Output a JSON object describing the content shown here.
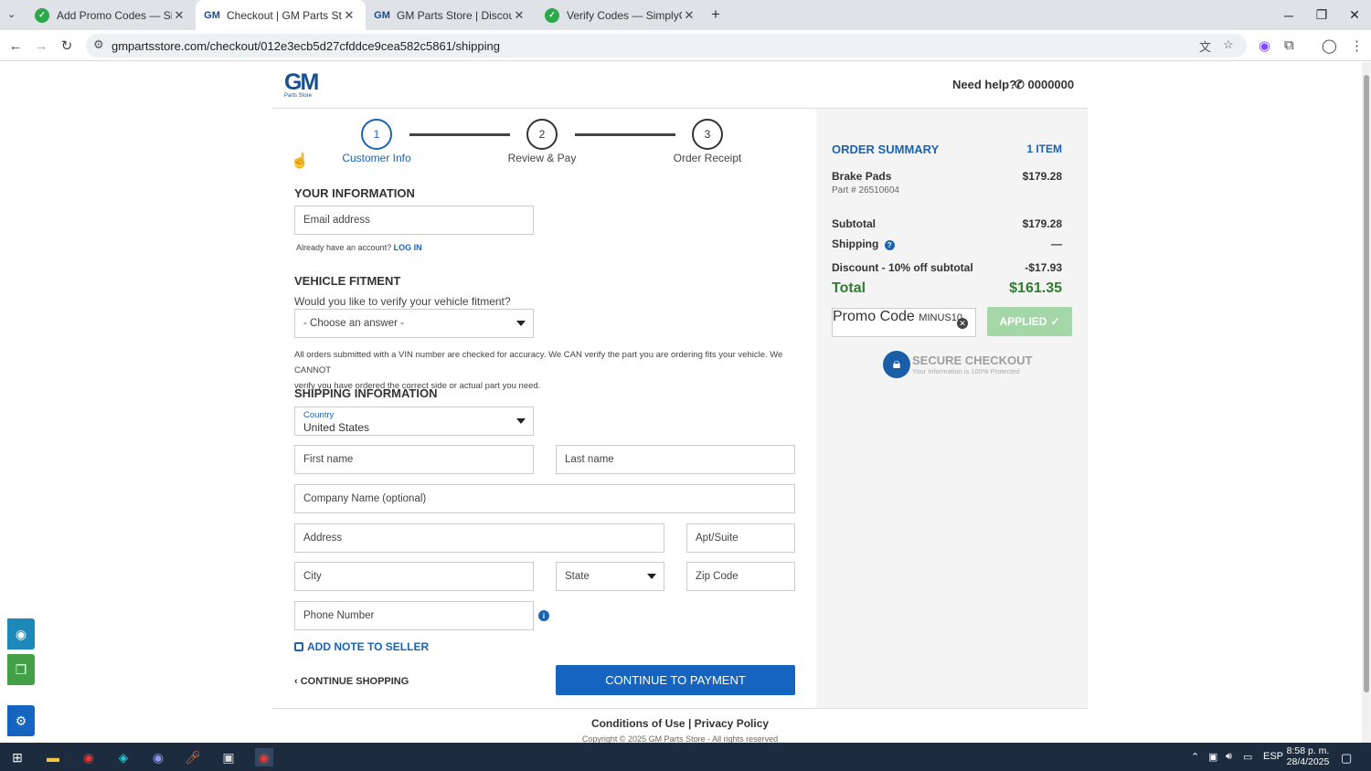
{
  "browser": {
    "tabs": [
      {
        "title": "Add Promo Codes — SimplyCo",
        "favicon": "simplycodes-icon",
        "active": false
      },
      {
        "title": "Checkout | GM Parts Store",
        "favicon": "gm-icon",
        "active": true
      },
      {
        "title": "GM Parts Store | Discount GM P",
        "favicon": "gm-icon",
        "active": false
      },
      {
        "title": "Verify Codes — SimplyCodes",
        "favicon": "simplycodes-icon",
        "active": false
      }
    ],
    "url": "gmpartsstore.com/checkout/012e3ecb5d27cfddce9cea582c5861/shipping"
  },
  "header": {
    "logo_text": "GM",
    "logo_sub": "Parts Store",
    "need_help": "Need help?",
    "phone": "0000000"
  },
  "stepper": {
    "steps": [
      {
        "number": "1",
        "label": "Customer Info"
      },
      {
        "number": "2",
        "label": "Review & Pay"
      },
      {
        "number": "3",
        "label": "Order Receipt"
      }
    ]
  },
  "your_info": {
    "heading": "YOUR INFORMATION",
    "email_placeholder": "Email address",
    "account_prompt": "Already have an account?",
    "login_link": "LOG IN"
  },
  "vehicle": {
    "heading": "VEHICLE FITMENT",
    "question": "Would you like to verify your vehicle fitment?",
    "select_value": "- Choose an answer -",
    "disclaimer_line1": "All orders submitted with a VIN number are checked for accuracy. We CAN verify the part you are ordering fits your vehicle. We CANNOT",
    "disclaimer_line2": "verify you have ordered the correct side or actual part you need."
  },
  "shipping": {
    "heading": "SHIPPING INFORMATION",
    "country_label": "Country",
    "country_value": "United States",
    "first_name": "First name",
    "last_name": "Last name",
    "company": "Company Name (optional)",
    "address": "Address",
    "apt": "Apt/Suite",
    "city": "City",
    "state": "State",
    "zip": "Zip Code",
    "phone": "Phone Number"
  },
  "actions": {
    "add_note": "ADD NOTE TO SELLER",
    "continue_shopping": "CONTINUE SHOPPING",
    "continue_payment": "CONTINUE TO PAYMENT"
  },
  "summary": {
    "title": "ORDER SUMMARY",
    "item_count": "1 ITEM",
    "item_name": "Brake Pads",
    "item_price": "$179.28",
    "part_number": "Part # 26510604",
    "subtotal_label": "Subtotal",
    "subtotal_value": "$179.28",
    "shipping_label": "Shipping",
    "shipping_value": "—",
    "discount_label": "Discount - 10% off subtotal",
    "discount_value": "-$17.93",
    "total_label": "Total",
    "total_value": "$161.35",
    "promo_label": "Promo Code",
    "promo_value": "MINUS10",
    "applied_label": "APPLIED",
    "secure_title": "SECURE CHECKOUT",
    "secure_sub": "Your Information is 100% Protected"
  },
  "footer": {
    "conditions": "Conditions of Use",
    "separator": "|",
    "privacy": "Privacy Policy",
    "copyright": "Copyright © 2025 GM Parts Store - All rights reserved"
  },
  "taskbar": {
    "language": "ESP",
    "time": "8:58 p. m.",
    "date": "28/4/2025"
  },
  "colors": {
    "brand_blue": "#1b63b5",
    "button_blue": "#1565c0",
    "total_green": "#2e7d32",
    "applied_green": "#a5d6a7"
  }
}
